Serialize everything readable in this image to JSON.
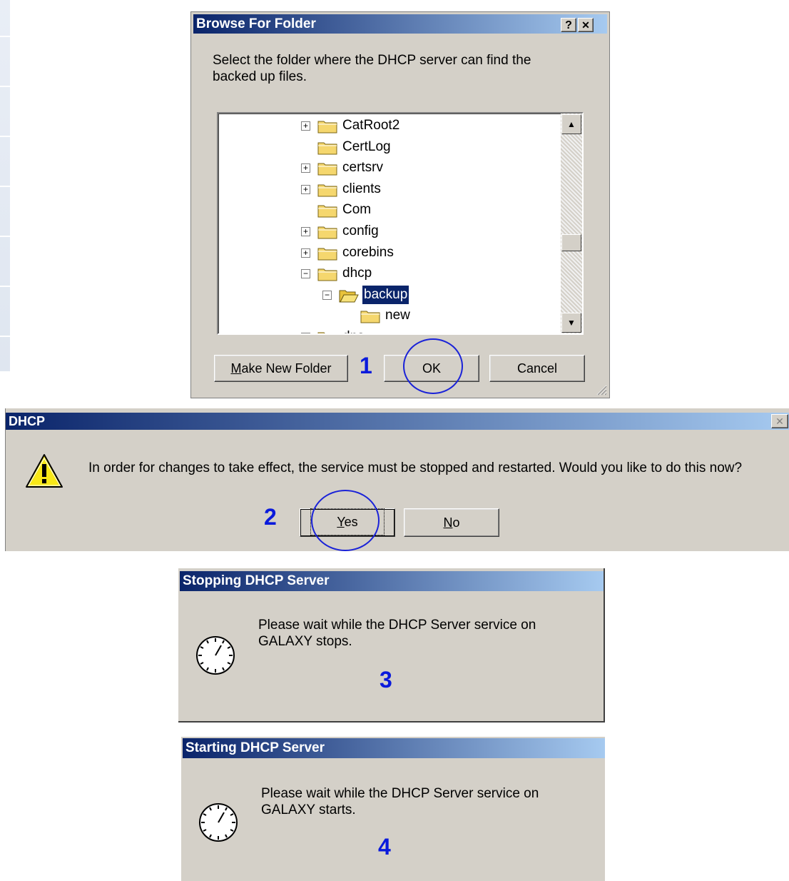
{
  "browse_dialog": {
    "title": "Browse For Folder",
    "help_label": "?",
    "close_label": "✕",
    "prompt": "Select the folder where the DHCP server can find the backed up files.",
    "tree": [
      {
        "label": "CatRoot2",
        "expander": "+",
        "depth": 0,
        "selected": false
      },
      {
        "label": "CertLog",
        "expander": "",
        "depth": 0,
        "selected": false
      },
      {
        "label": "certsrv",
        "expander": "+",
        "depth": 0,
        "selected": false
      },
      {
        "label": "clients",
        "expander": "+",
        "depth": 0,
        "selected": false
      },
      {
        "label": "Com",
        "expander": "",
        "depth": 0,
        "selected": false
      },
      {
        "label": "config",
        "expander": "+",
        "depth": 0,
        "selected": false
      },
      {
        "label": "corebins",
        "expander": "+",
        "depth": 0,
        "selected": false
      },
      {
        "label": "dhcp",
        "expander": "−",
        "depth": 0,
        "selected": false
      },
      {
        "label": "backup",
        "expander": "−",
        "depth": 1,
        "selected": true
      },
      {
        "label": "new",
        "expander": "",
        "depth": 2,
        "selected": false
      },
      {
        "label": "dns",
        "expander": "−",
        "depth": 0,
        "selected": false
      }
    ],
    "make_new_folder_label": "Make New Folder",
    "ok_label": "OK",
    "cancel_label": "Cancel",
    "step_number": "1"
  },
  "dhcp_dialog": {
    "title": "DHCP",
    "close_label": "✕",
    "message": "In order for changes to take effect, the service must be stopped and restarted.  Would you like to do this now?",
    "yes_label": "Yes",
    "no_label": "No",
    "step_number": "2"
  },
  "stopping_dialog": {
    "title": "Stopping DHCP Server",
    "message_line1": "Please wait while the DHCP Server service on",
    "message_line2": "GALAXY stops.",
    "step_number": "3"
  },
  "starting_dialog": {
    "title": "Starting DHCP Server",
    "message_line1": "Please wait while the DHCP Server service on",
    "message_line2": "GALAXY starts.",
    "step_number": "4"
  },
  "colors": {
    "title_gradient_start": "#0a246a",
    "title_gradient_end": "#a6caf0",
    "dialog_face": "#d4d0c8",
    "annotation_blue": "#1a22d8"
  }
}
